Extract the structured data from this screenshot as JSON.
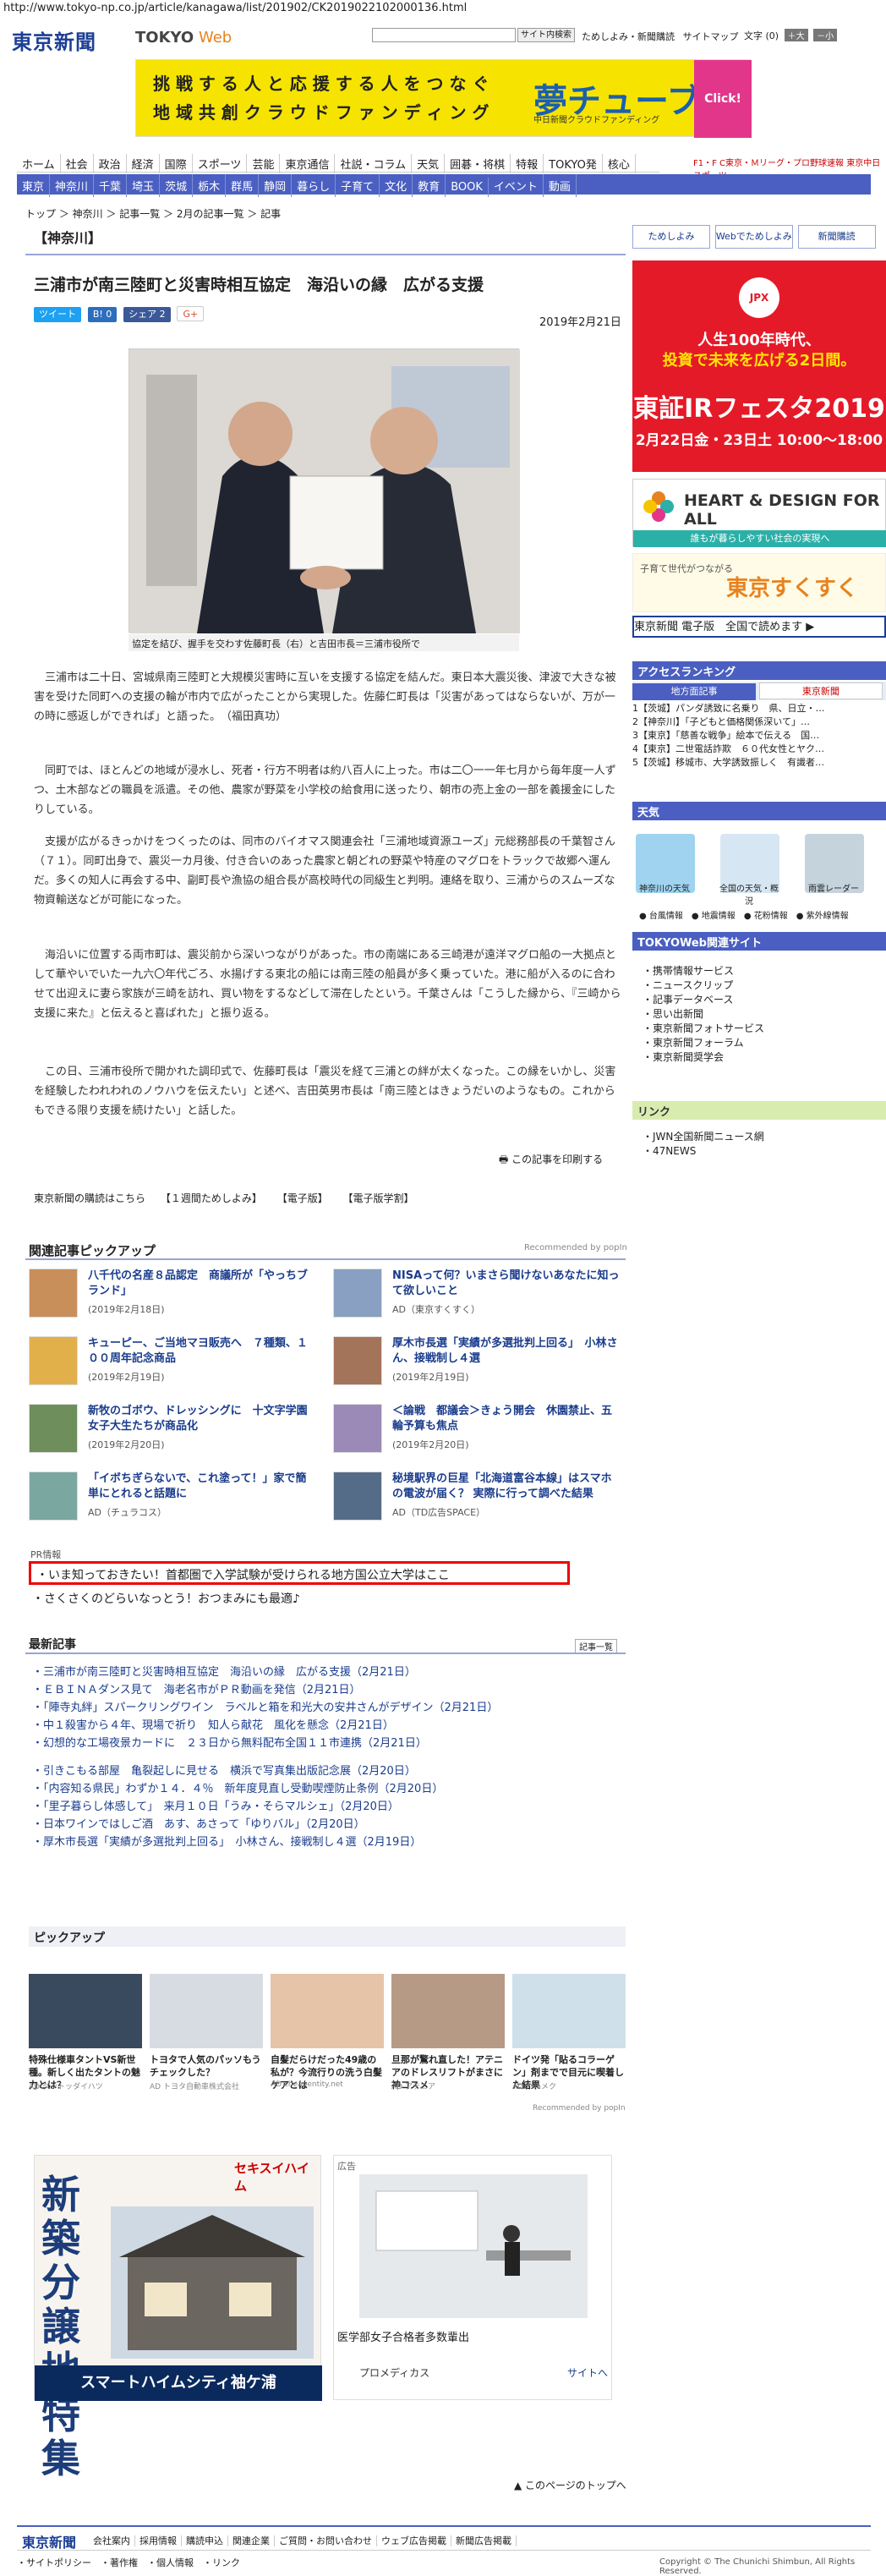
{
  "url": "http://www.tokyo-np.co.jp/article/kanagawa/list/201902/CK2019022102000136.html",
  "header": {
    "logo": "東京新聞",
    "logo_web_prefix": "TOKYO",
    "logo_web_suffix": "Web",
    "search_button": "サイト内検索",
    "links": [
      "ためしよみ・新聞購読",
      "サイトマップ"
    ],
    "font_label": "文字",
    "font_reset": "(0)",
    "font_big": "＋大",
    "font_small": "－小"
  },
  "banner": {
    "line1": "挑 戦 す る 人 と 応 援 す る 人 を つ な ぐ",
    "line2": "地 域 共 創 ク ラ ウ ド フ ァ ン デ ィ ン グ",
    "logo": "夢チューブ",
    "sub": "中日新聞クラウドファンディング",
    "click": "Click!"
  },
  "nav1": [
    "ホーム",
    "社会",
    "政治",
    "経済",
    "国際",
    "スポーツ",
    "芸能",
    "東京通信",
    "社説・コラム",
    "天気",
    "囲碁・将棋",
    "特報",
    "TOKYO発",
    "核心"
  ],
  "nav_chunichi": "F1・F C東京・Ｍリーグ・プロ野球速報 東京中日スポーツ",
  "nav2": [
    "東京",
    "神奈川",
    "千葉",
    "埼玉",
    "茨城",
    "栃木",
    "群馬",
    "静岡",
    "暮らし",
    "子育て",
    "文化",
    "教育",
    "BOOK",
    "イベント",
    "動画"
  ],
  "breadcrumb": "トップ ＞ 神奈川 ＞ 記事一覧 ＞ 2月の記事一覧 ＞ 記事",
  "section_label": "【神奈川】",
  "article": {
    "title": "三浦市が南三陸町と災害時相互協定　海沿いの縁　広がる支援",
    "date": "2019年2月21日",
    "share": {
      "tweet": "ツイート",
      "hatena": "B! 0",
      "fb": "シェア 2",
      "gplus": "G+"
    },
    "photo_caption": "協定を結び、握手を交わす佐藤町長（右）と吉田市長＝三浦市役所で",
    "paragraphs": [
      "三浦市は二十日、宮城県南三陸町と大規模災害時に互いを支援する協定を結んだ。東日本大震災後、津波で大きな被害を受けた同町への支援の輪が市内で広がったことから実現した。佐藤仁町長は「災害があってはならないが、万が一の時に感返しができれば」と語った。　（福田真功）",
      "同町では、ほとんどの地域が浸水し、死者・行方不明者は約八百人に上った。市は二〇一一年七月から毎年度一人ずつ、土木部などの職員を派遣。その他、農家が野菜を小学校の給食用に送ったり、朝市の売上金の一部を義援金にしたりしている。",
      "支援が広がるきっかけをつくったのは、同市のバイオマス関連会社「三浦地域資源ユーズ」元総務部長の千葉智さん（７１）。同町出身で、震災一カ月後、付き合いのあった農家と朝どれの野菜や特産のマグロをトラックで故郷へ運んだ。多くの知人に再会する中、副町長や漁協の組合長が高校時代の同級生と判明。連絡を取り、三浦からのスムーズな物資輸送などが可能になった。",
      "海沿いに位置する両市町は、震災前から深いつながりがあった。市の南端にある三崎港が遠洋マグロ船の一大拠点として華やいでいた一九六〇年代ごろ、水揚げする東北の船には南三陸の船員が多く乗っていた。港に船が入るのに合わせて出迎えに妻ら家族が三崎を訪れ、買い物をするなどして滞在したという。千葉さんは「こうした縁から、『三崎から支援に来た』と伝えると喜ばれた」と振り返る。",
      "この日、三浦市役所で開かれた調印式で、佐藤町長は「震災を経て三浦との絆が太くなった。この縁をいかし、災害を経験したわれわれのノウハウを伝えたい」と述べ、吉田英男市長は「南三陸とはきょうだいのようなもの。これからもできる限り支援を続けたい」と話した。"
    ],
    "print_link": "この記事を印刷する"
  },
  "footer_links": [
    "東京新聞の購読はこちら",
    "【１週間ためしよみ】",
    "【電子版】",
    "【電子版学割】"
  ],
  "related": {
    "title": "関連記事ピックアップ",
    "rec_by": "Recommended by popIn",
    "items": [
      {
        "title": "八千代の名産８品認定　商議所が「やっちブランド」",
        "sub": "(2019年2月18日)"
      },
      {
        "title": "NISAって何？いまさら聞けないあなたに知って欲しいこと",
        "sub": "AD（東京すくすく）"
      },
      {
        "title": "キューピー、ご当地マヨ販売へ　７種類、１００周年記念商品",
        "sub": "(2019年2月19日)"
      },
      {
        "title": "厚木市長選「実績が多選批判上回る」　小林さん、接戦制し４選",
        "sub": "(2019年2月19日)"
      },
      {
        "title": "新牧のゴボウ、ドレッシングに　十文字学園女子大生たちが商品化",
        "sub": "(2019年2月20日)"
      },
      {
        "title": "＜論戦　都議会＞きょう開会　休園禁止、五輪予算も焦点",
        "sub": "(2019年2月20日)"
      },
      {
        "title": "「イボちぎらないで、これ塗って！」家で簡単にとれると話題に",
        "sub": "AD（チュラコス）"
      },
      {
        "title": "秘境駅界の巨星「北海道富谷本線」はスマホの電波が届く？ 実際に行って調べた結果",
        "sub": "AD（TD広告SPACE）"
      }
    ]
  },
  "pr": {
    "label": "PR情報",
    "items": [
      "いま知っておきたい！首都圏で入学試験が受けられる地方国公立大学はここ",
      "さくさくのどらいなっとう！おつまみにも最適♪"
    ]
  },
  "latest": {
    "title": "最新記事",
    "list_btn": "記事一覧",
    "items": [
      "三浦市が南三陸町と災害時相互協定　海沿いの縁　広がる支援（2月21日）",
      "ＥＢＩＮＡダンス見て　海老名市がＰＲ動画を発信（2月21日）",
      "「陣寺丸絆」スパークリングワイン　ラベルと箱を和光大の安井さんがデザイン（2月21日）",
      "中１殺害から４年、現場で祈り　知人ら献花　風化を懸念（2月21日）",
      "幻想的な工場夜景カードに　２３日から無料配布全国１１市連携（2月21日）",
      "引きこもる部屋　亀裂起しに見せる　横浜で写真集出版記念展（2月20日）",
      "「内容知る県民」わずか１４．４％　新年度見直し受動喫煙防止条例（2月20日）",
      "「里子暮らし体感して」　来月１０日「うみ・そらマルシェ」（2月20日）",
      "日本ワインではしご酒　あす、あさって「ゆりバル」（2月20日）",
      "厚木市長選「実績が多選批判上回る」　小林さん、接戦制し４選（2月19日）"
    ]
  },
  "pickup": {
    "title": "ピックアップ",
    "rec_by": "Recommended by popIn",
    "items": [
      {
        "title": "特殊仕様車タントVS新世種。新しく出たタントの魅力とは？",
        "ad": "AD ダントッダイハツ"
      },
      {
        "title": "トヨタで人気のパッソもうチェックした？",
        "ad": "AD トヨタ自動車株式会社"
      },
      {
        "title": "自髪だらけだった49歳の私が？今流行りの洗う白髪ケアとは",
        "ad": "AD cheapentity.net"
      },
      {
        "title": "旦那が驚れ直した！アテニアのドレスリフトがまさに神コスメ",
        "ad": "AD アテニア"
      },
      {
        "title": "ドイツ発「貼るコラーゲン」剤までで目元に喫着した結果",
        "ad": "AD ハルメク"
      }
    ]
  },
  "ad_bottom_left": {
    "brand": "セキスイハイム",
    "big": "新築分譲地特集",
    "bottom": "スマートハイムシティ袖ケ浦"
  },
  "ad_bottom_right": {
    "label": "広告",
    "caption": "医学部女子合格者多数輩出",
    "brand": "プロメディカス",
    "site": "サイトへ"
  },
  "pagetop": "このページのトップへ",
  "footer": {
    "logo": "東京新聞",
    "links": [
      "会社案内",
      "採用情報",
      "購読申込",
      "関連企業",
      "ご質問・お問い合わせ",
      "ウェブ広告掲載",
      "新聞広告掲載"
    ],
    "links2": "・サイトポリシー　・著作権　・個人情報　・リンク",
    "copyright": "Copyright © The Chunichi Shimbun, All Rights Reserved."
  },
  "right": {
    "buttons": [
      "ためしよみ",
      "Webでためしよみ",
      "新聞購読"
    ],
    "jpx": {
      "logo": "JPX",
      "t1": "人生100年時代、",
      "t2": "投資で未来を広げる2日間。",
      "t3": "東証IRフェスタ2019",
      "t4": "2月22日金・23日土 10:00～18:00"
    },
    "hd": {
      "title": "HEART & DESIGN FOR ALL",
      "sub": "誰もが暮らしやすい社会の実現へ"
    },
    "suku": {
      "small": "子育て世代がつながる",
      "big": "東京すくすく"
    },
    "denshi": "東京新聞 電子版　全国で読めます ▶",
    "ranking_head": "アクセスランキング",
    "ranking_tabs": [
      "地方面記事",
      "東京新聞"
    ],
    "ranking": [
      "1【茨城】パンダ誘致に名乗り　県、日立・…",
      "2【神奈川】「子どもと価格関係深いて」…",
      "3【東京】「慈善な戦争」絵本で伝える　国…",
      "4【東京】二世電話詐欺　６０代女性とヤク…",
      "5【茨城】移城市、大学誘致振しく　有識者…"
    ],
    "weather_head": "天気",
    "weather": [
      "神奈川の天気",
      "全国の天気・概況",
      "雨雲レーダー"
    ],
    "weather_links": [
      "台風情報",
      "地震情報",
      "花粉情報",
      "紫外線情報"
    ],
    "tokyoweb_head": "TOKYOWeb関連サイト",
    "tokyoweb": [
      "携帯情報サービス",
      "ニュースクリップ",
      "記事データベース",
      "思い出新聞",
      "東京新聞フォトサービス",
      "東京新聞フォーラム",
      "東京新聞奨学会"
    ],
    "link_head": "リンク",
    "links": [
      "JWN全国新聞ニュース網",
      "47NEWS"
    ]
  }
}
